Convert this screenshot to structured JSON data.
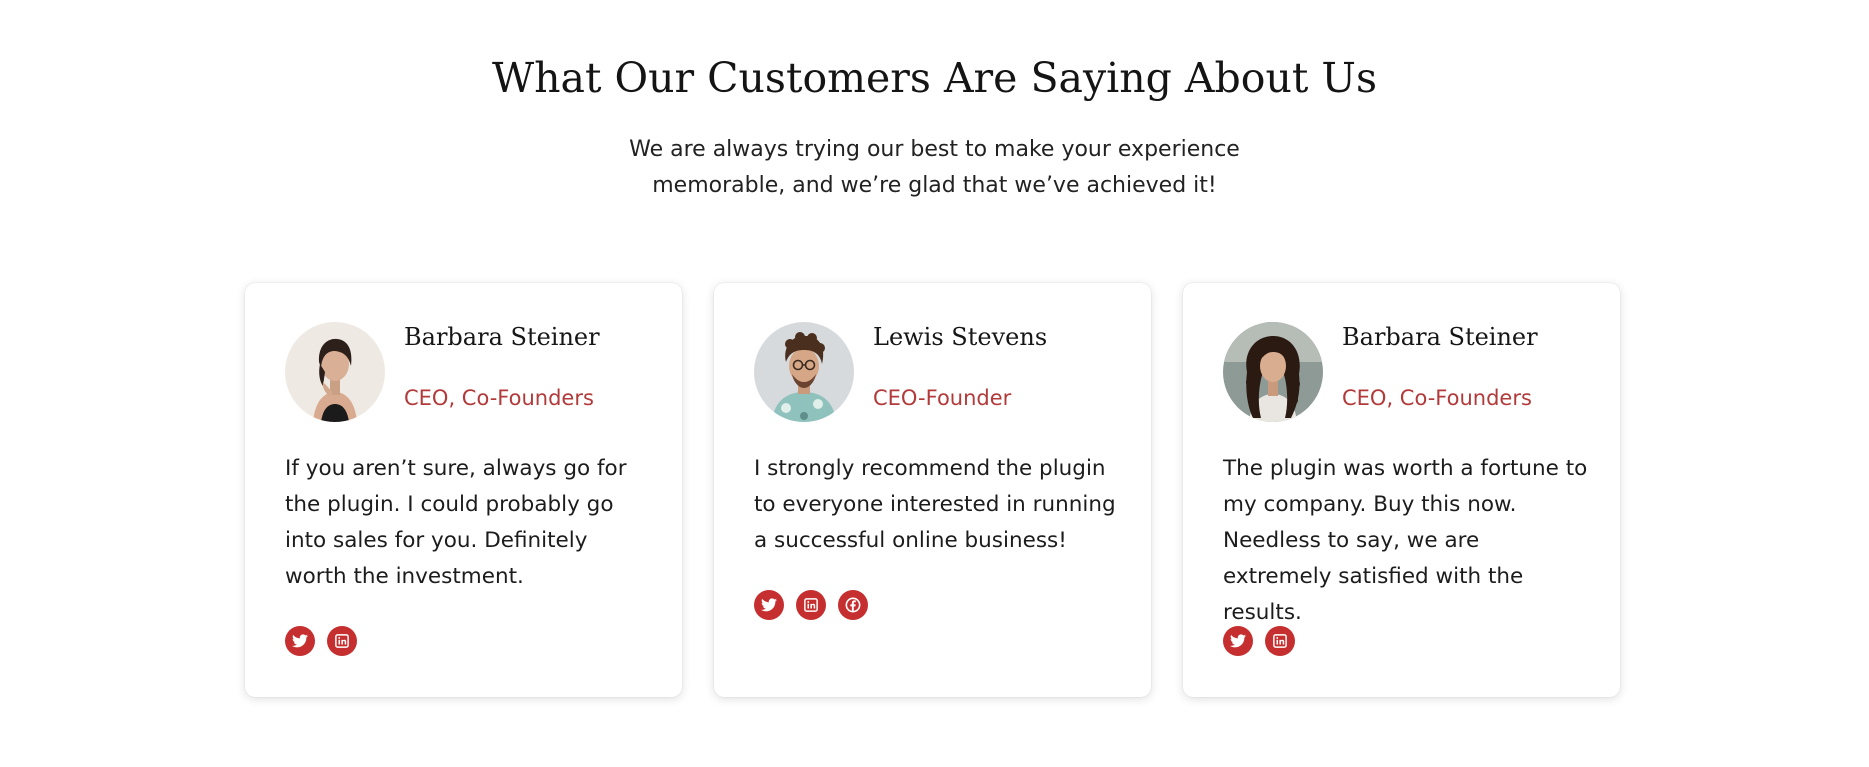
{
  "section": {
    "title": "What Our Customers Are Saying About Us",
    "subtitle": "We are always trying our best to make your experience memorable, and we’re glad that we’ve achieved it!"
  },
  "testimonials": [
    {
      "name": "Barbara Steiner",
      "role": "CEO, Co-Founders",
      "quote": "If you aren’t sure, always go for the plugin. I could probably go into sales for you. Definitely worth the investment.",
      "socials": [
        "twitter-icon",
        "linkedin-icon"
      ]
    },
    {
      "name": "Lewis Stevens",
      "role": "CEO-Founder",
      "quote": "I strongly recommend the plugin to everyone interested in running a successful online business!",
      "socials": [
        "twitter-icon",
        "linkedin-icon",
        "facebook-icon"
      ]
    },
    {
      "name": "Barbara Steiner",
      "role": "CEO, Co-Founders",
      "quote": "The plugin was worth a fortune to my company. Buy this now. Needless to say, we are extremely satisfied with the results.",
      "socials": [
        "twitter-icon",
        "linkedin-icon"
      ]
    }
  ],
  "colors": {
    "accent": "#c62f2f",
    "role_text": "#b23a3a",
    "heading_text": "#141414"
  }
}
